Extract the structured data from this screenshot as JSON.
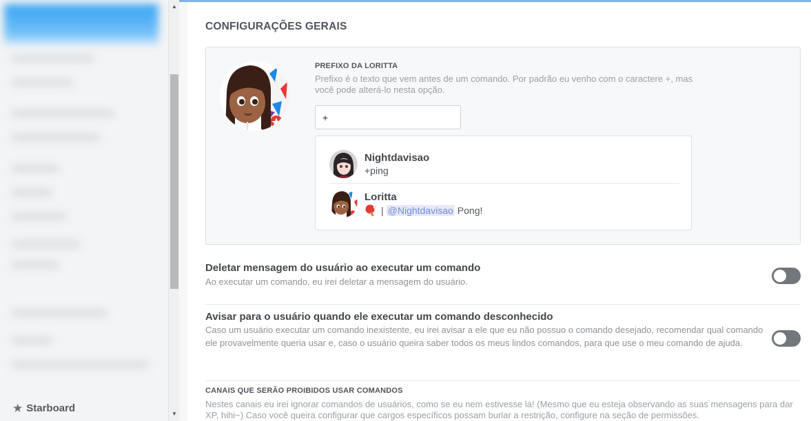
{
  "sidebar": {
    "bottom_item": {
      "label": "Starboard",
      "icon": "star-icon"
    }
  },
  "general": {
    "title": "CONFIGURAÇÕES GERAIS",
    "prefix": {
      "label": "PREFIXO DA LORITTA",
      "description": "Prefixo é o texto que vem antes de um comando. Por padrão eu venho com o caractere +, mas você pode alterá-lo nesta opção.",
      "value": "+"
    },
    "preview": {
      "messages": [
        {
          "author": "Nightdavisao",
          "text": "+ping"
        },
        {
          "author": "Loritta",
          "separator": "|",
          "mention": "@Nightdavisao",
          "text": "Pong!"
        }
      ]
    }
  },
  "settings": [
    {
      "title": "Deletar mensagem do usuário ao executar um comando",
      "description": "Ao executar um comando, eu irei deletar a mensagem do usuário.",
      "enabled": false
    },
    {
      "title": "Avisar para o usuário quando ele executar um comando desconhecido",
      "description": "Caso um usuário executar um comando inexistente, eu irei avisar a ele que eu não possuo o comando desejado, recomendar qual comando ele provavelmente queria usar e, caso o usuário queira saber todos os meus lindos comandos, para que use o meu comando de ajuda.",
      "enabled": false
    }
  ],
  "channels": {
    "label": "CANAIS QUE SERÃO PROIBIDOS USAR COMANDOS",
    "description": "Nestes canais eu irei ignorar comandos de usuários, como se eu nem estivesse lá! (Mesmo que eu esteja observando as suas mensagens para dar XP, hihi~) Caso você queira configurar que cargos específicos possam burlar a restrição, configure na seção de permissões."
  },
  "colors": {
    "accent": "#7289da",
    "toggle_off": "#72767d"
  }
}
